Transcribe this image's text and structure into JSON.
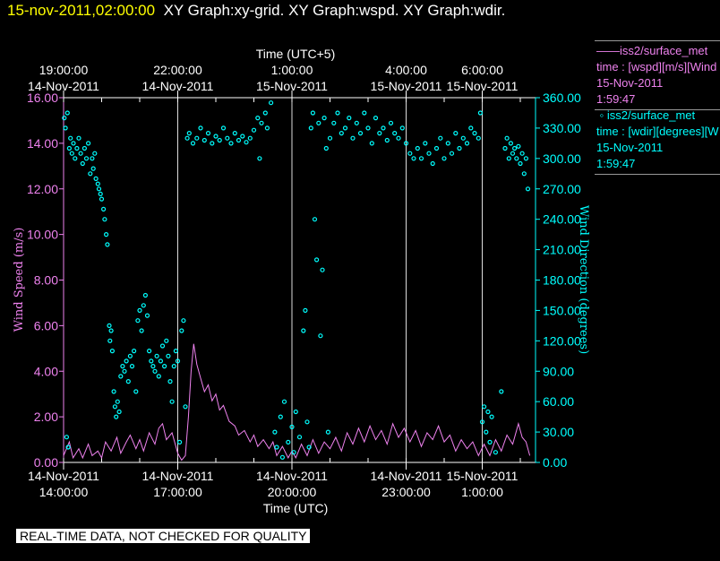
{
  "header": {
    "date": "15-nov-2011,02:00:00",
    "title": "XY Graph:xy-grid.  XY Graph:wspd.  XY Graph:wdir."
  },
  "legend": [
    {
      "symbol": "——",
      "name": "iss2/surface_met",
      "desc": "time : [wspd][m/s][Wind",
      "date": "15-Nov-2011",
      "time": "1:59:47",
      "color": "#ee82ee"
    },
    {
      "symbol": "◦",
      "name": "iss2/surface_met",
      "desc": "time : [wdir][degrees][W",
      "date": "15-Nov-2011",
      "time": "1:59:47",
      "color": "#00ffff"
    }
  ],
  "note": "REAL-TIME DATA, NOT CHECKED FOR QUALITY",
  "chart_data": {
    "type": "scatter+line",
    "x_unit": "hours since 14-Nov-2011 14:00 UTC",
    "xlim": [
      0,
      12.4
    ],
    "xlabel_bottom": "Time (UTC)",
    "xlabel_top": "Time (UTC+5)",
    "bottom_ticks": [
      {
        "x": 0,
        "l1": "14-Nov-2011",
        "l2": "14:00:00"
      },
      {
        "x": 3,
        "l1": "14-Nov-2011",
        "l2": "17:00:00"
      },
      {
        "x": 6,
        "l1": "14-Nov-2011",
        "l2": "20:00:00"
      },
      {
        "x": 9,
        "l1": "14-Nov-2011",
        "l2": "23:00:00"
      },
      {
        "x": 11,
        "l1": "15-Nov-2011",
        "l2": "1:00:00"
      }
    ],
    "top_ticks": [
      {
        "x": 0,
        "l1": "19:00:00",
        "l2": "14-Nov-2011"
      },
      {
        "x": 3,
        "l1": "22:00:00",
        "l2": "14-Nov-2011"
      },
      {
        "x": 6,
        "l1": "1:00:00",
        "l2": "15-Nov-2011"
      },
      {
        "x": 9,
        "l1": "4:00:00",
        "l2": "15-Nov-2011"
      },
      {
        "x": 11,
        "l1": "6:00:00",
        "l2": "15-Nov-2011"
      }
    ],
    "grid_x": [
      3,
      6,
      9,
      11
    ],
    "ylabel_left": "Wind Speed (m/s)",
    "ylim_left": [
      0,
      16
    ],
    "yticks_left": [
      "0.00",
      "2.00",
      "4.00",
      "6.00",
      "8.00",
      "10.00",
      "12.00",
      "14.00",
      "16.00"
    ],
    "ylabel_right": "Wind Direction (degrees)",
    "ylim_right": [
      0,
      360
    ],
    "yticks_right": [
      "0.00",
      "30.00",
      "60.00",
      "90.00",
      "120.00",
      "150.00",
      "180.00",
      "210.00",
      "240.00",
      "270.00",
      "300.00",
      "330.00",
      "360.00"
    ],
    "series": [
      {
        "name": "wspd",
        "axis": "left",
        "style": "line",
        "color": "#ee82ee",
        "points": [
          [
            0,
            0.3
          ],
          [
            0.15,
            0.9
          ],
          [
            0.25,
            0.2
          ],
          [
            0.4,
            0.6
          ],
          [
            0.5,
            0.2
          ],
          [
            0.65,
            0.8
          ],
          [
            0.75,
            0.3
          ],
          [
            0.9,
            0.5
          ],
          [
            1,
            0.2
          ],
          [
            1.1,
            0.9
          ],
          [
            1.25,
            0.5
          ],
          [
            1.4,
            1.1
          ],
          [
            1.5,
            0.4
          ],
          [
            1.65,
            0.9
          ],
          [
            1.75,
            1.2
          ],
          [
            1.9,
            0.6
          ],
          [
            2,
            1.0
          ],
          [
            2.1,
            0.5
          ],
          [
            2.25,
            1.3
          ],
          [
            2.4,
            0.8
          ],
          [
            2.5,
            1.5
          ],
          [
            2.6,
            1.7
          ],
          [
            2.7,
            1.0
          ],
          [
            2.85,
            1.3
          ],
          [
            3,
            0.4
          ],
          [
            3.1,
            0.1
          ],
          [
            3.2,
            0.3
          ],
          [
            3.28,
            2.0
          ],
          [
            3.35,
            4.0
          ],
          [
            3.42,
            5.2
          ],
          [
            3.5,
            4.3
          ],
          [
            3.6,
            3.7
          ],
          [
            3.7,
            3.1
          ],
          [
            3.8,
            3.4
          ],
          [
            3.9,
            2.7
          ],
          [
            4,
            3.0
          ],
          [
            4.1,
            2.3
          ],
          [
            4.2,
            2.5
          ],
          [
            4.35,
            1.8
          ],
          [
            4.5,
            1.6
          ],
          [
            4.6,
            1.2
          ],
          [
            4.75,
            1.4
          ],
          [
            4.9,
            0.9
          ],
          [
            5,
            1.2
          ],
          [
            5.1,
            0.7
          ],
          [
            5.25,
            1.0
          ],
          [
            5.4,
            0.6
          ],
          [
            5.5,
            0.9
          ],
          [
            5.6,
            0.3
          ],
          [
            5.75,
            0.7
          ],
          [
            5.9,
            0.2
          ],
          [
            6,
            0.5
          ],
          [
            6.1,
            0.2
          ],
          [
            6.25,
            0.8
          ],
          [
            6.4,
            0.3
          ],
          [
            6.55,
            1.0
          ],
          [
            6.7,
            0.4
          ],
          [
            6.85,
            0.9
          ],
          [
            7,
            0.6
          ],
          [
            7.15,
            1.1
          ],
          [
            7.3,
            0.5
          ],
          [
            7.45,
            1.3
          ],
          [
            7.6,
            0.8
          ],
          [
            7.75,
            1.5
          ],
          [
            7.9,
            0.9
          ],
          [
            8.05,
            1.6
          ],
          [
            8.2,
            1.0
          ],
          [
            8.35,
            1.4
          ],
          [
            8.5,
            0.8
          ],
          [
            8.65,
            1.7
          ],
          [
            8.8,
            1.1
          ],
          [
            8.95,
            1.5
          ],
          [
            9.1,
            0.9
          ],
          [
            9.25,
            1.4
          ],
          [
            9.4,
            0.7
          ],
          [
            9.55,
            1.3
          ],
          [
            9.7,
            1.0
          ],
          [
            9.85,
            1.6
          ],
          [
            10,
            0.9
          ],
          [
            10.15,
            1.2
          ],
          [
            10.3,
            0.5
          ],
          [
            10.45,
            1.0
          ],
          [
            10.6,
            0.6
          ],
          [
            10.75,
            0.9
          ],
          [
            10.9,
            0.3
          ],
          [
            11.05,
            0.8
          ],
          [
            11.2,
            0.3
          ],
          [
            11.35,
            1.0
          ],
          [
            11.5,
            0.5
          ],
          [
            11.65,
            1.2
          ],
          [
            11.8,
            0.8
          ],
          [
            11.95,
            1.7
          ],
          [
            12.05,
            1.1
          ],
          [
            12.15,
            0.9
          ],
          [
            12.25,
            0.3
          ]
        ]
      },
      {
        "name": "wdir",
        "axis": "right",
        "style": "circle",
        "color": "#00ffff",
        "points": [
          [
            0.02,
            340
          ],
          [
            0.05,
            330
          ],
          [
            0.08,
            25
          ],
          [
            0.1,
            345
          ],
          [
            0.12,
            15
          ],
          [
            0.15,
            310
          ],
          [
            0.18,
            320
          ],
          [
            0.22,
            305
          ],
          [
            0.26,
            315
          ],
          [
            0.3,
            300
          ],
          [
            0.35,
            310
          ],
          [
            0.4,
            320
          ],
          [
            0.45,
            305
          ],
          [
            0.5,
            295
          ],
          [
            0.55,
            310
          ],
          [
            0.6,
            300
          ],
          [
            0.65,
            315
          ],
          [
            0.7,
            285
          ],
          [
            0.75,
            300
          ],
          [
            0.78,
            290
          ],
          [
            0.82,
            305
          ],
          [
            0.85,
            280
          ],
          [
            0.9,
            275
          ],
          [
            0.93,
            270
          ],
          [
            0.97,
            265
          ],
          [
            1.0,
            260
          ],
          [
            1.05,
            250
          ],
          [
            1.08,
            240
          ],
          [
            1.12,
            225
          ],
          [
            1.15,
            215
          ],
          [
            1.2,
            135
          ],
          [
            1.22,
            120
          ],
          [
            1.25,
            130
          ],
          [
            1.28,
            110
          ],
          [
            1.32,
            70
          ],
          [
            1.35,
            55
          ],
          [
            1.38,
            45
          ],
          [
            1.42,
            60
          ],
          [
            1.46,
            50
          ],
          [
            1.5,
            85
          ],
          [
            1.55,
            95
          ],
          [
            1.6,
            90
          ],
          [
            1.65,
            100
          ],
          [
            1.7,
            80
          ],
          [
            1.75,
            105
          ],
          [
            1.8,
            95
          ],
          [
            1.85,
            110
          ],
          [
            1.9,
            70
          ],
          [
            1.95,
            140
          ],
          [
            2.0,
            150
          ],
          [
            2.05,
            130
          ],
          [
            2.1,
            155
          ],
          [
            2.15,
            165
          ],
          [
            2.2,
            145
          ],
          [
            2.25,
            110
          ],
          [
            2.3,
            100
          ],
          [
            2.35,
            95
          ],
          [
            2.4,
            90
          ],
          [
            2.45,
            105
          ],
          [
            2.5,
            85
          ],
          [
            2.55,
            100
          ],
          [
            2.6,
            115
          ],
          [
            2.65,
            95
          ],
          [
            2.7,
            120
          ],
          [
            2.75,
            105
          ],
          [
            2.8,
            80
          ],
          [
            2.85,
            60
          ],
          [
            2.9,
            95
          ],
          [
            2.95,
            110
          ],
          [
            3.0,
            100
          ],
          [
            3.05,
            20
          ],
          [
            3.1,
            130
          ],
          [
            3.15,
            140
          ],
          [
            3.2,
            55
          ],
          [
            3.25,
            320
          ],
          [
            3.3,
            325
          ],
          [
            3.4,
            315
          ],
          [
            3.5,
            320
          ],
          [
            3.6,
            330
          ],
          [
            3.7,
            318
          ],
          [
            3.8,
            325
          ],
          [
            3.9,
            315
          ],
          [
            4.0,
            322
          ],
          [
            4.1,
            318
          ],
          [
            4.2,
            330
          ],
          [
            4.3,
            320
          ],
          [
            4.4,
            315
          ],
          [
            4.5,
            325
          ],
          [
            4.6,
            318
          ],
          [
            4.7,
            322
          ],
          [
            4.8,
            316
          ],
          [
            4.9,
            320
          ],
          [
            5.0,
            328
          ],
          [
            5.1,
            340
          ],
          [
            5.15,
            300
          ],
          [
            5.2,
            335
          ],
          [
            5.3,
            345
          ],
          [
            5.35,
            330
          ],
          [
            5.45,
            355
          ],
          [
            5.55,
            30
          ],
          [
            5.6,
            15
          ],
          [
            5.7,
            45
          ],
          [
            5.75,
            5
          ],
          [
            5.8,
            60
          ],
          [
            5.9,
            20
          ],
          [
            6.0,
            35
          ],
          [
            6.05,
            10
          ],
          [
            6.1,
            50
          ],
          [
            6.2,
            25
          ],
          [
            6.3,
            130
          ],
          [
            6.35,
            150
          ],
          [
            6.4,
            40
          ],
          [
            6.45,
            15
          ],
          [
            6.5,
            330
          ],
          [
            6.55,
            345
          ],
          [
            6.6,
            240
          ],
          [
            6.65,
            200
          ],
          [
            6.7,
            335
          ],
          [
            6.75,
            125
          ],
          [
            6.8,
            190
          ],
          [
            6.85,
            340
          ],
          [
            6.9,
            310
          ],
          [
            6.95,
            30
          ],
          [
            7.0,
            320
          ],
          [
            7.1,
            335
          ],
          [
            7.2,
            345
          ],
          [
            7.3,
            325
          ],
          [
            7.4,
            330
          ],
          [
            7.5,
            340
          ],
          [
            7.6,
            320
          ],
          [
            7.7,
            335
          ],
          [
            7.8,
            325
          ],
          [
            7.9,
            345
          ],
          [
            8.0,
            330
          ],
          [
            8.1,
            315
          ],
          [
            8.2,
            340
          ],
          [
            8.3,
            325
          ],
          [
            8.4,
            330
          ],
          [
            8.5,
            318
          ],
          [
            8.6,
            335
          ],
          [
            8.7,
            325
          ],
          [
            8.8,
            320
          ],
          [
            8.9,
            330
          ],
          [
            9.0,
            315
          ],
          [
            9.1,
            305
          ],
          [
            9.2,
            300
          ],
          [
            9.3,
            310
          ],
          [
            9.4,
            300
          ],
          [
            9.5,
            315
          ],
          [
            9.6,
            305
          ],
          [
            9.7,
            295
          ],
          [
            9.8,
            310
          ],
          [
            9.9,
            320
          ],
          [
            10.0,
            300
          ],
          [
            10.1,
            315
          ],
          [
            10.2,
            305
          ],
          [
            10.3,
            325
          ],
          [
            10.4,
            310
          ],
          [
            10.5,
            320
          ],
          [
            10.6,
            315
          ],
          [
            10.7,
            330
          ],
          [
            10.8,
            325
          ],
          [
            10.9,
            320
          ],
          [
            10.95,
            345
          ],
          [
            11.0,
            40
          ],
          [
            11.05,
            55
          ],
          [
            11.1,
            30
          ],
          [
            11.15,
            50
          ],
          [
            11.2,
            20
          ],
          [
            11.25,
            45
          ],
          [
            11.35,
            10
          ],
          [
            11.5,
            70
          ],
          [
            11.6,
            310
          ],
          [
            11.65,
            320
          ],
          [
            11.7,
            300
          ],
          [
            11.75,
            315
          ],
          [
            11.8,
            305
          ],
          [
            11.85,
            310
          ],
          [
            11.9,
            300
          ],
          [
            11.95,
            312
          ],
          [
            12.0,
            295
          ],
          [
            12.05,
            305
          ],
          [
            12.1,
            285
          ],
          [
            12.15,
            300
          ],
          [
            12.2,
            270
          ]
        ]
      }
    ]
  }
}
